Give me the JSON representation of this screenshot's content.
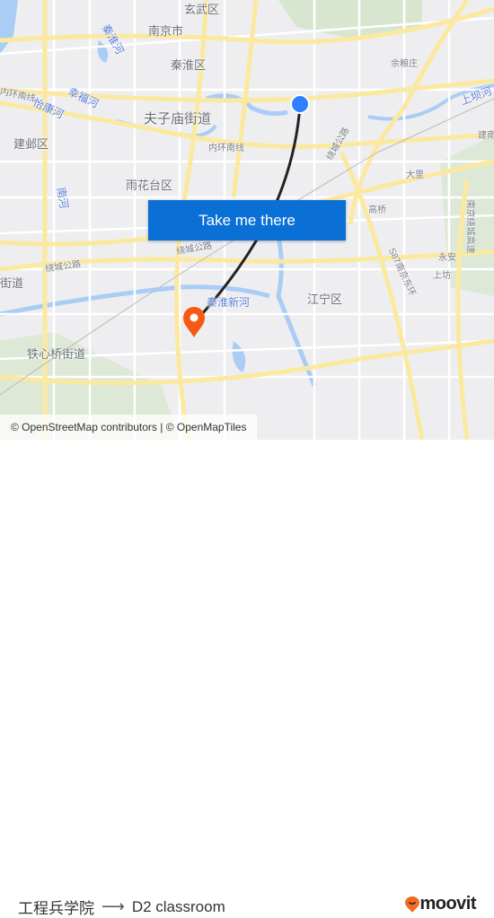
{
  "map": {
    "labels": {
      "xuanwu": "玄武区",
      "nanjing": "南京市",
      "qinhuai": "秦淮区",
      "fuzimiao": "夫子庙街道",
      "jianye": "建邺区",
      "yuhuatai": "雨花台区",
      "neihuan1": "内环南线",
      "neihuan2": "内环南线",
      "yiqiao": "怡康河",
      "xingfu": "幸福河",
      "qinhuaihe": "秦淮河",
      "yulaizhuang": "余粮庄",
      "shangba": "上坝河",
      "dali": "大里",
      "gaoqiao": "高桥",
      "raocheng": "绕城公路",
      "raocheng2": "绕城公路",
      "raocheng3": "绕城公路",
      "jiangning": "江宁区",
      "qinhuaixinhe": "秦淮新河",
      "tiexinqiao": "铁心桥街道",
      "jiedao": "街道",
      "yongan": "永安",
      "shangfang": "上坊",
      "s87": "S87南京东环",
      "raochenggaosu": "南京绕城高速",
      "nanhe": "南河",
      "jian": "建南"
    },
    "origin_marker_color": "#2f7fff",
    "destination_marker_color": "#f55a14",
    "route_line_color": "#222222"
  },
  "cta": {
    "label": "Take me there",
    "color": "#0a70d6"
  },
  "attribution": "© OpenStreetMap contributors | © OpenMapTiles",
  "footer": {
    "origin": "工程兵学院",
    "arrow_icon": "arrow-right-icon",
    "destination": "D2 classroom",
    "logo_text": "moovit",
    "logo_color": "#f26b21"
  }
}
